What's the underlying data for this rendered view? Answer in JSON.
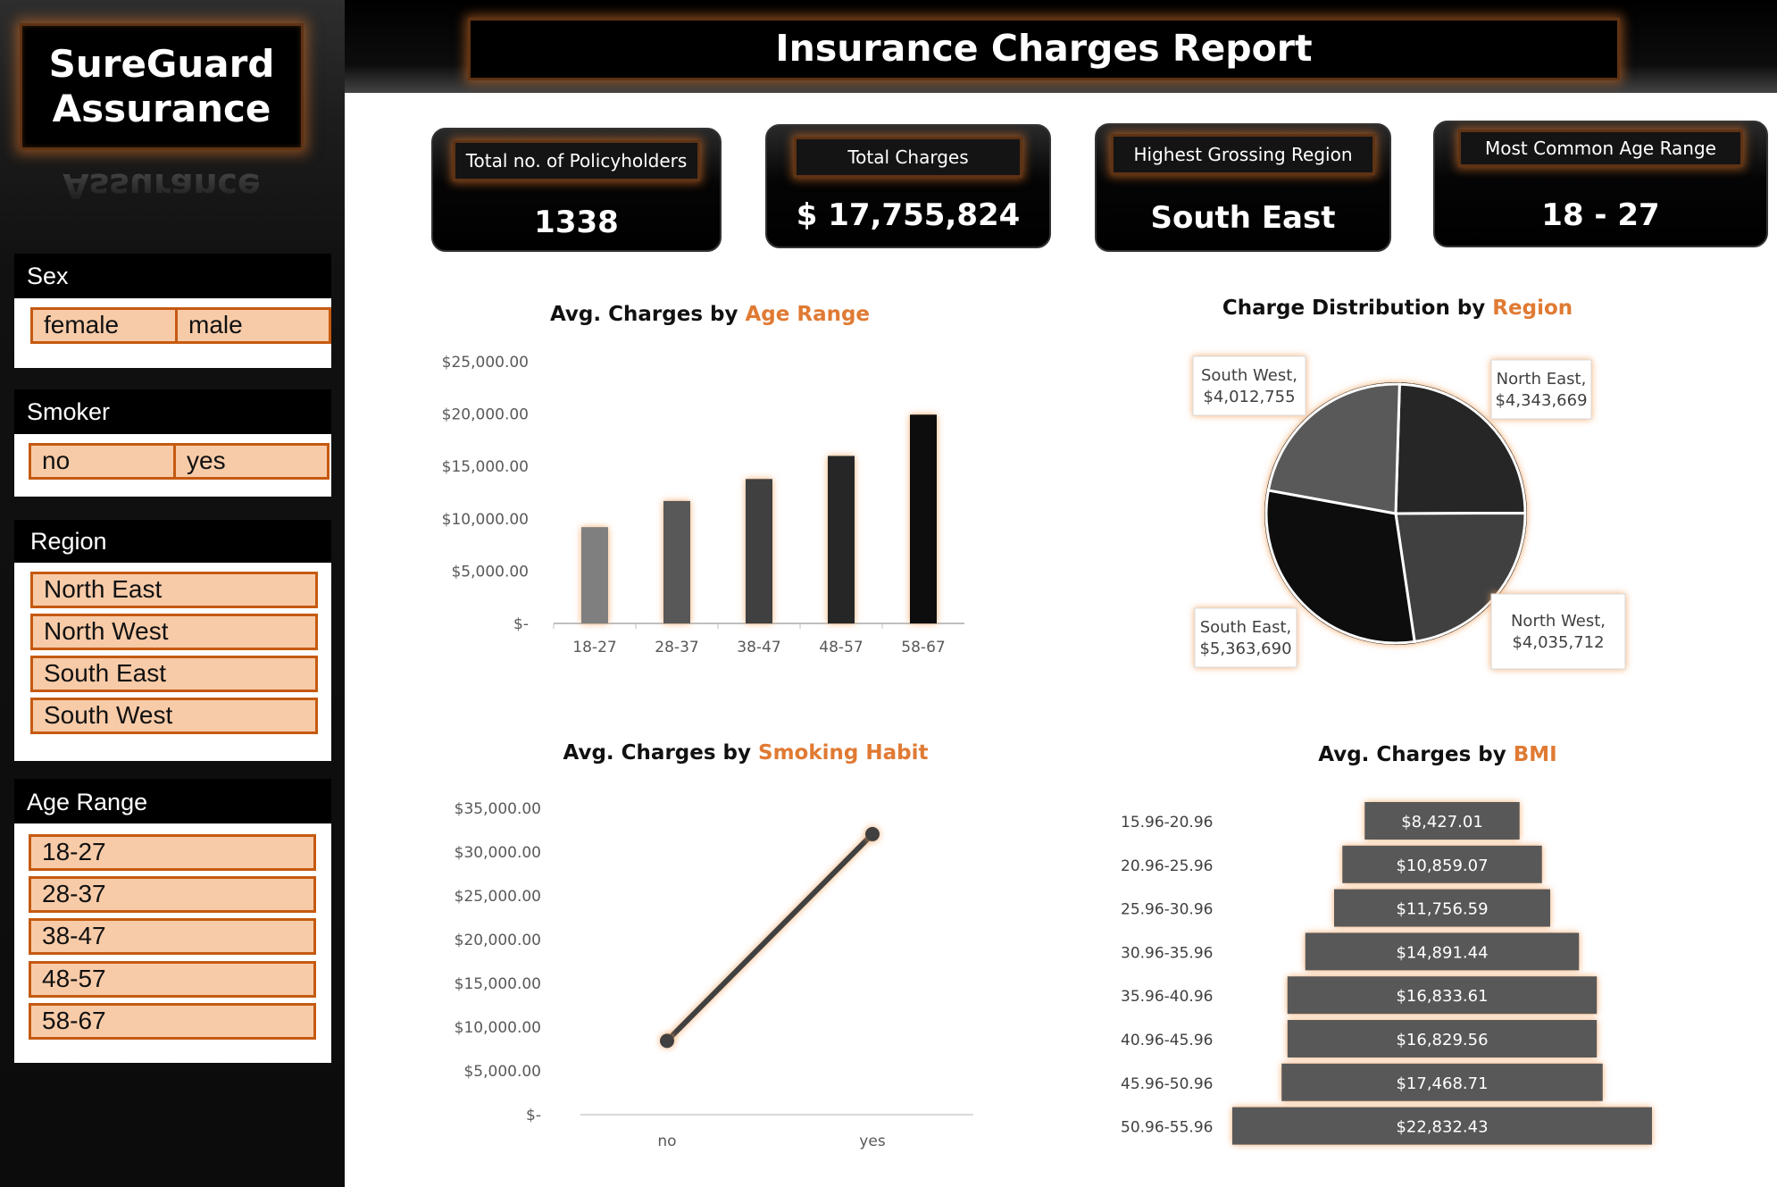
{
  "brand": {
    "line1": "SureGuard",
    "line2": "Assurance",
    "reflection": "Assurance"
  },
  "header": {
    "title": "Insurance Charges Report"
  },
  "slicers": {
    "sex": {
      "title": "Sex",
      "items": [
        "female",
        "male"
      ]
    },
    "smoker": {
      "title": "Smoker",
      "items": [
        "no",
        "yes"
      ]
    },
    "region": {
      "title": "Region",
      "items": [
        "North East",
        "North West",
        "South East",
        "South West"
      ]
    },
    "age_range": {
      "title": "Age Range",
      "items": [
        "18-27",
        "28-37",
        "38-47",
        "48-57",
        "58-67"
      ]
    }
  },
  "kpis": [
    {
      "label": "Total no. of Policyholders",
      "value": "1338"
    },
    {
      "label": "Total Charges",
      "value": "$ 17,755,824"
    },
    {
      "label": "Highest Grossing Region",
      "value": "South East"
    },
    {
      "label": "Most Common Age Range",
      "value": "18 - 27"
    }
  ],
  "colors": {
    "accent": "#e07a33",
    "slicer_fill": "#f8cba8",
    "slicer_border": "#c55a11",
    "glow": "#f4a460"
  },
  "chart_data": [
    {
      "type": "bar",
      "title_prefix": "Avg. Charges by ",
      "title_accent": "Age Range",
      "categories": [
        "18-27",
        "28-37",
        "38-47",
        "48-57",
        "58-67"
      ],
      "values": [
        9200,
        11700,
        13800,
        16000,
        19950
      ],
      "bar_colors": [
        "#7f7f7f",
        "#595959",
        "#404040",
        "#262626",
        "#0d0d0d"
      ],
      "ylim": [
        0,
        25000
      ],
      "yticks": [
        0,
        5000,
        10000,
        15000,
        20000,
        25000
      ],
      "ytick_labels": [
        "$-",
        "$5,000.00",
        "$10,000.00",
        "$15,000.00",
        "$20,000.00",
        "$25,000.00"
      ],
      "grid": false
    },
    {
      "type": "pie",
      "title_prefix": "Charge Distribution by ",
      "title_accent": "Region",
      "slices": [
        {
          "label": "North East,",
          "value_label": "$4,343,669",
          "value": 4343669,
          "color": "#262626"
        },
        {
          "label": "North West,",
          "value_label": "$4,035,712",
          "value": 4035712,
          "color": "#404040"
        },
        {
          "label": "South East,",
          "value_label": "$5,363,690",
          "value": 5363690,
          "color": "#0d0d0d"
        },
        {
          "label": "South West,",
          "value_label": "$4,012,755",
          "value": 4012755,
          "color": "#595959"
        }
      ]
    },
    {
      "type": "line",
      "title_prefix": "Avg. Charges by ",
      "title_accent": "Smoking Habit",
      "categories": [
        "no",
        "yes"
      ],
      "values": [
        8434,
        32050
      ],
      "ylim": [
        0,
        35000
      ],
      "yticks": [
        0,
        5000,
        10000,
        15000,
        20000,
        25000,
        30000,
        35000
      ],
      "ytick_labels": [
        "$-",
        "$5,000.00",
        "$10,000.00",
        "$15,000.00",
        "$20,000.00",
        "$25,000.00",
        "$30,000.00",
        "$35,000.00"
      ],
      "grid": false
    },
    {
      "type": "bar",
      "orientation": "horizontal-funnel",
      "title_prefix": "Avg. Charges by ",
      "title_accent": "BMI",
      "categories": [
        "15.96-20.96",
        "20.96-25.96",
        "25.96-30.96",
        "30.96-35.96",
        "35.96-40.96",
        "40.96-45.96",
        "45.96-50.96",
        "50.96-55.96"
      ],
      "values": [
        8427.01,
        10859.07,
        11756.59,
        14891.44,
        16833.61,
        16829.56,
        17468.71,
        22832.43
      ],
      "value_labels": [
        "$8,427.01",
        "$10,859.07",
        "$11,756.59",
        "$14,891.44",
        "$16,833.61",
        "$16,829.56",
        "$17,468.71",
        "$22,832.43"
      ]
    }
  ]
}
